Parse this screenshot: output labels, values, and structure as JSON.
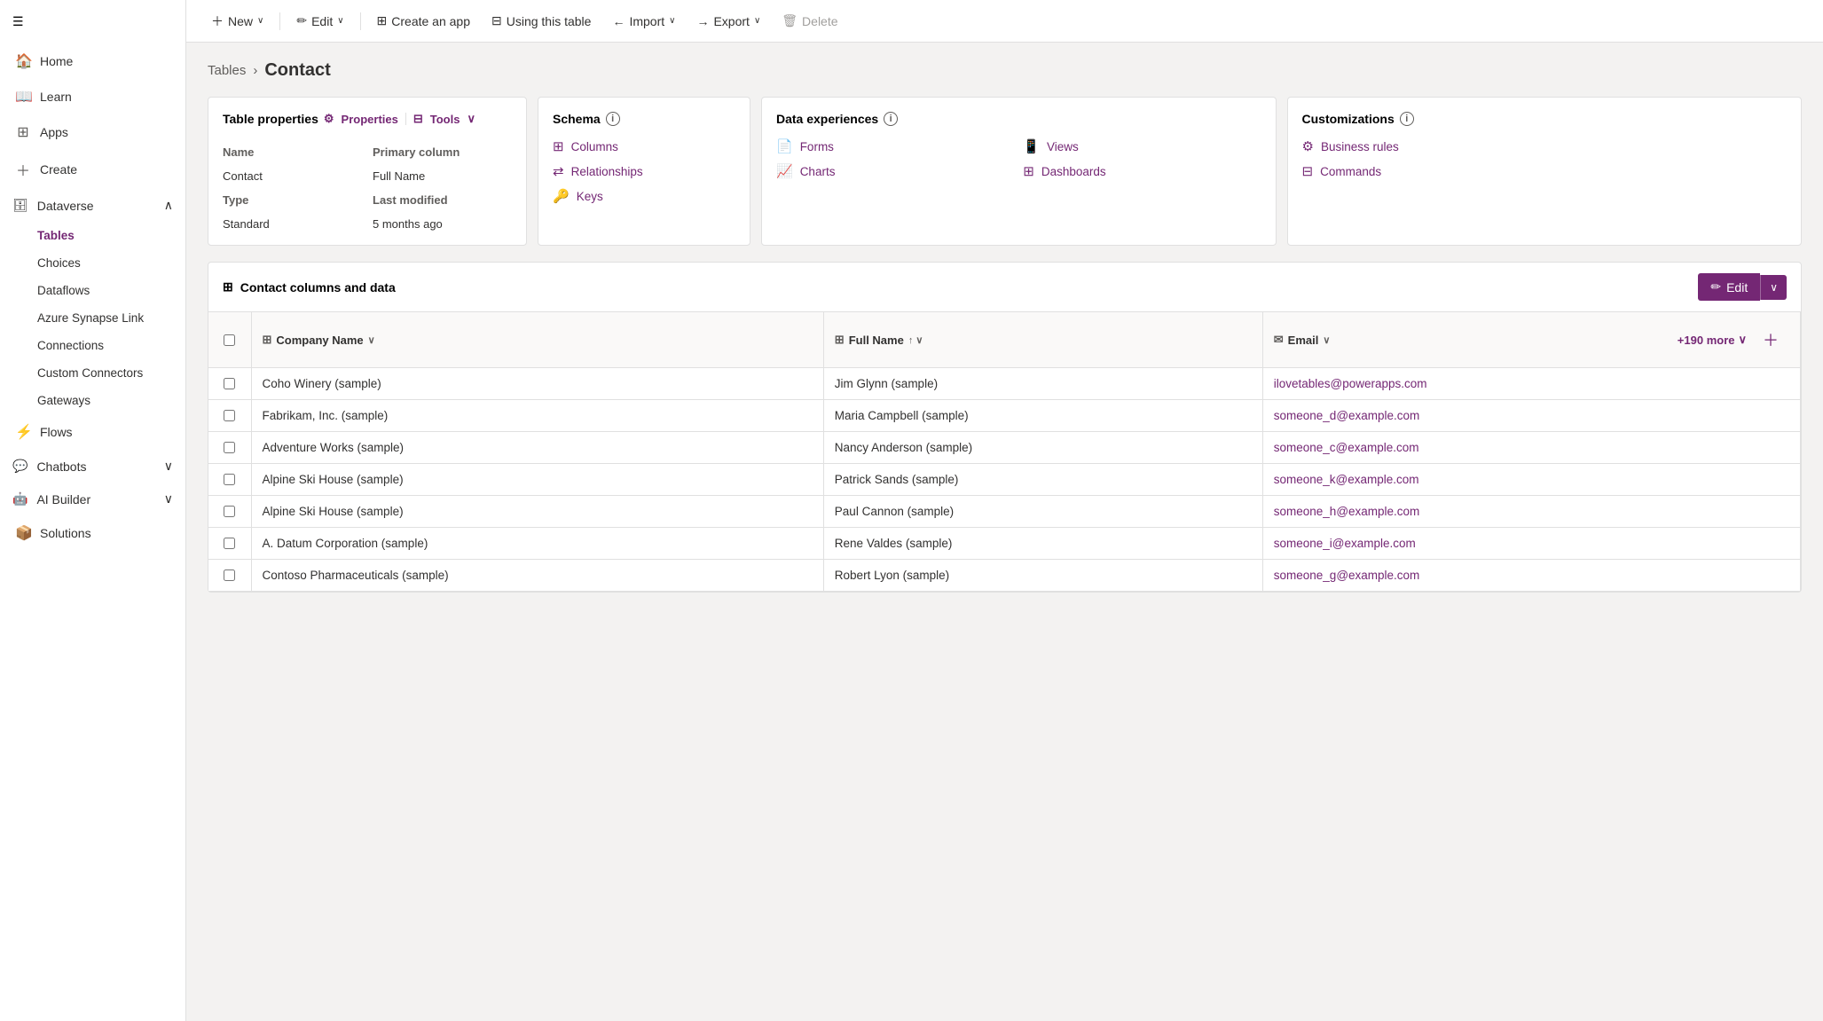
{
  "sidebar": {
    "hamburger": "☰",
    "items": [
      {
        "id": "home",
        "label": "Home",
        "icon": "🏠"
      },
      {
        "id": "learn",
        "label": "Learn",
        "icon": "📖"
      },
      {
        "id": "apps",
        "label": "Apps",
        "icon": "⊞"
      },
      {
        "id": "create",
        "label": "Create",
        "icon": "+"
      },
      {
        "id": "dataverse",
        "label": "Dataverse",
        "icon": "🗄",
        "expanded": true
      },
      {
        "id": "flows",
        "label": "Flows",
        "icon": "⚡"
      },
      {
        "id": "chatbots",
        "label": "Chatbots",
        "icon": "💬",
        "hasChevron": true
      },
      {
        "id": "ai-builder",
        "label": "AI Builder",
        "icon": "🤖",
        "hasChevron": true
      },
      {
        "id": "solutions",
        "label": "Solutions",
        "icon": "📦"
      }
    ],
    "dataverse_subitems": [
      {
        "id": "tables",
        "label": "Tables",
        "active": true
      },
      {
        "id": "choices",
        "label": "Choices"
      },
      {
        "id": "dataflows",
        "label": "Dataflows"
      },
      {
        "id": "azure-synapse",
        "label": "Azure Synapse Link"
      },
      {
        "id": "connections",
        "label": "Connections"
      },
      {
        "id": "custom-connectors",
        "label": "Custom Connectors"
      },
      {
        "id": "gateways",
        "label": "Gateways"
      }
    ]
  },
  "toolbar": {
    "new_label": "New",
    "edit_label": "Edit",
    "create_app_label": "Create an app",
    "using_table_label": "Using this table",
    "import_label": "Import",
    "export_label": "Export",
    "delete_label": "Delete"
  },
  "breadcrumb": {
    "parent": "Tables",
    "separator": "›",
    "current": "Contact"
  },
  "table_properties": {
    "title": "Table properties",
    "properties_link": "Properties",
    "tools_link": "Tools",
    "name_label": "Name",
    "name_value": "Contact",
    "primary_column_label": "Primary column",
    "primary_column_value": "Full Name",
    "type_label": "Type",
    "type_value": "Standard",
    "last_modified_label": "Last modified",
    "last_modified_value": "5 months ago"
  },
  "schema": {
    "title": "Schema",
    "items": [
      {
        "id": "columns",
        "label": "Columns",
        "icon": "⊞"
      },
      {
        "id": "relationships",
        "label": "Relationships",
        "icon": "⇄"
      },
      {
        "id": "keys",
        "label": "Keys",
        "icon": "🔑"
      }
    ]
  },
  "data_experiences": {
    "title": "Data experiences",
    "items": [
      {
        "id": "forms",
        "label": "Forms",
        "icon": "📄"
      },
      {
        "id": "views",
        "label": "Views",
        "icon": "📱"
      },
      {
        "id": "charts",
        "label": "Charts",
        "icon": "📈"
      },
      {
        "id": "dashboards",
        "label": "Dashboards",
        "icon": "⊞"
      }
    ]
  },
  "customizations": {
    "title": "Customizations",
    "items": [
      {
        "id": "business-rules",
        "label": "Business rules",
        "icon": "⚙"
      },
      {
        "id": "commands",
        "label": "Commands",
        "icon": "⊟"
      }
    ]
  },
  "data_section": {
    "title": "Contact columns and data",
    "edit_label": "Edit",
    "more_cols_label": "+190 more",
    "columns": [
      {
        "id": "company",
        "label": "Company Name",
        "icon": "⊞",
        "sort": "∨"
      },
      {
        "id": "fullname",
        "label": "Full Name",
        "icon": "⊞",
        "sort": "↑∨"
      },
      {
        "id": "email",
        "label": "Email",
        "icon": "✉",
        "sort": "∨"
      }
    ],
    "rows": [
      {
        "company": "Coho Winery (sample)",
        "fullname": "Jim Glynn (sample)",
        "email": "ilovetables@powerapps.com"
      },
      {
        "company": "Fabrikam, Inc. (sample)",
        "fullname": "Maria Campbell (sample)",
        "email": "someone_d@example.com"
      },
      {
        "company": "Adventure Works (sample)",
        "fullname": "Nancy Anderson (sample)",
        "email": "someone_c@example.com"
      },
      {
        "company": "Alpine Ski House (sample)",
        "fullname": "Patrick Sands (sample)",
        "email": "someone_k@example.com"
      },
      {
        "company": "Alpine Ski House (sample)",
        "fullname": "Paul Cannon (sample)",
        "email": "someone_h@example.com"
      },
      {
        "company": "A. Datum Corporation (sample)",
        "fullname": "Rene Valdes (sample)",
        "email": "someone_i@example.com"
      },
      {
        "company": "Contoso Pharmaceuticals (sample)",
        "fullname": "Robert Lyon (sample)",
        "email": "someone_g@example.com"
      }
    ]
  }
}
